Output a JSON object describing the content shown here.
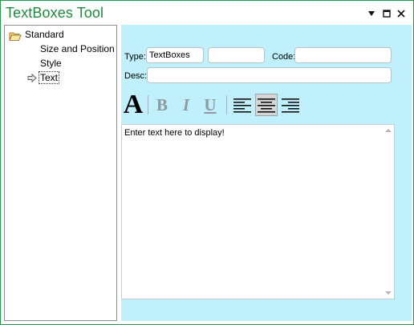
{
  "window": {
    "title": "TextBoxes Tool",
    "accent_color": "#1d8a3e",
    "panel_color": "#bff0fb",
    "controls": [
      "dropdown-icon",
      "maximize-icon",
      "close-icon"
    ]
  },
  "sidebar": {
    "root": {
      "label": "Standard",
      "icon": "folder-open-icon"
    },
    "items": [
      {
        "label": "Size and Position"
      },
      {
        "label": "Style"
      },
      {
        "label": "Text",
        "selected": true,
        "icon": "arrow-right-icon"
      }
    ]
  },
  "form": {
    "type_label": "Type:",
    "type_value": "TextBoxes",
    "second_value": "",
    "code_label": "Code:",
    "code_value": "",
    "desc_label": "Desc:",
    "desc_value": ""
  },
  "toolbar": {
    "font": {
      "glyph": "A",
      "icon": "font-icon"
    },
    "bold": {
      "glyph": "B",
      "icon": "bold-icon"
    },
    "italic": {
      "glyph": "I",
      "icon": "italic-icon"
    },
    "underline": {
      "glyph": "U",
      "icon": "underline-icon"
    },
    "align": [
      {
        "name": "align-left-icon",
        "active": false
      },
      {
        "name": "align-center-icon",
        "active": true
      },
      {
        "name": "align-right-icon",
        "active": false
      }
    ]
  },
  "editor": {
    "text": "Enter text here to display!"
  }
}
